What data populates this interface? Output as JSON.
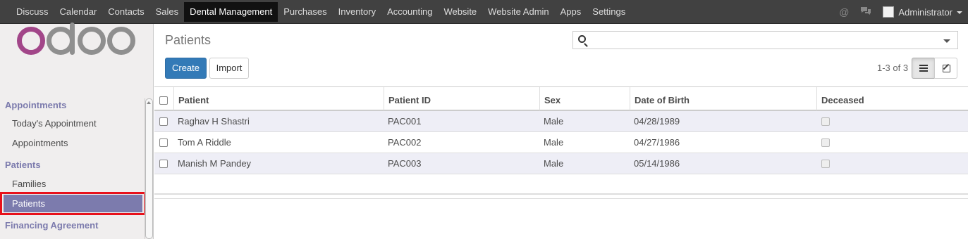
{
  "topbar": {
    "menu": [
      "Discuss",
      "Calendar",
      "Contacts",
      "Sales",
      "Dental Management",
      "Purchases",
      "Inventory",
      "Accounting",
      "Website",
      "Website Admin",
      "Apps",
      "Settings"
    ],
    "active": "Dental Management",
    "user": "Administrator"
  },
  "sidebar": {
    "sections": [
      {
        "title": "Appointments",
        "items": [
          "Today's Appointment",
          "Appointments"
        ]
      },
      {
        "title": "Patients",
        "items": [
          "Families",
          "Patients"
        ]
      },
      {
        "title": "Financing Agreement",
        "items": []
      }
    ],
    "active_item": "Patients",
    "brand_colors": {
      "accent": "#a24689",
      "grey": "#8f8f8f",
      "section": "#7c7bad"
    }
  },
  "main": {
    "title": "Patients",
    "create_label": "Create",
    "import_label": "Import",
    "pager": "1-3 of 3",
    "search_value": "",
    "columns": [
      "Patient",
      "Patient ID",
      "Sex",
      "Date of Birth",
      "Deceased"
    ],
    "rows": [
      {
        "patient": "Raghav H Shastri",
        "patient_id": "PAC001",
        "sex": "Male",
        "dob": "04/28/1989",
        "deceased": false
      },
      {
        "patient": "Tom A Riddle",
        "patient_id": "PAC002",
        "sex": "Male",
        "dob": "04/27/1986",
        "deceased": false
      },
      {
        "patient": "Manish M Pandey",
        "patient_id": "PAC003",
        "sex": "Male",
        "dob": "05/14/1986",
        "deceased": false
      }
    ]
  },
  "icons": {
    "search": "search-icon",
    "list_view": "list-view-icon",
    "form_view": "edit-icon",
    "mention": "at-icon",
    "chat": "chat-icon",
    "dropdown": "caret-down-icon"
  }
}
